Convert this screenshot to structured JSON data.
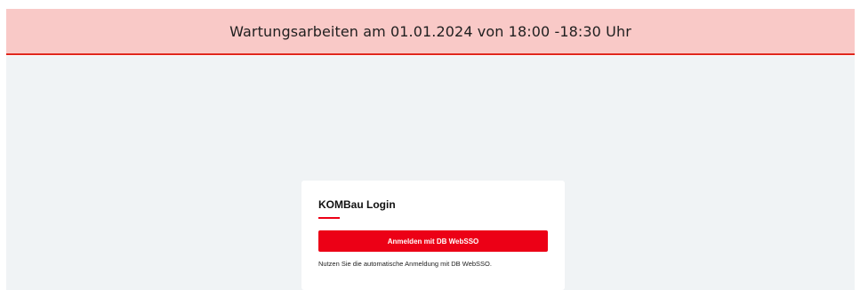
{
  "banner": {
    "text": "Wartungsarbeiten am 01.01.2024 von 18:00 -18:30 Uhr"
  },
  "login": {
    "title": "KOMBau Login",
    "button_label": "Anmelden mit DB WebSSO",
    "hint": "Nutzen Sie die automatische Anmeldung mit DB WebSSO."
  },
  "colors": {
    "brand_red": "#ec0016",
    "banner_background": "#f9c9c7",
    "banner_border": "#e0281e",
    "page_background": "#f0f3f5"
  }
}
